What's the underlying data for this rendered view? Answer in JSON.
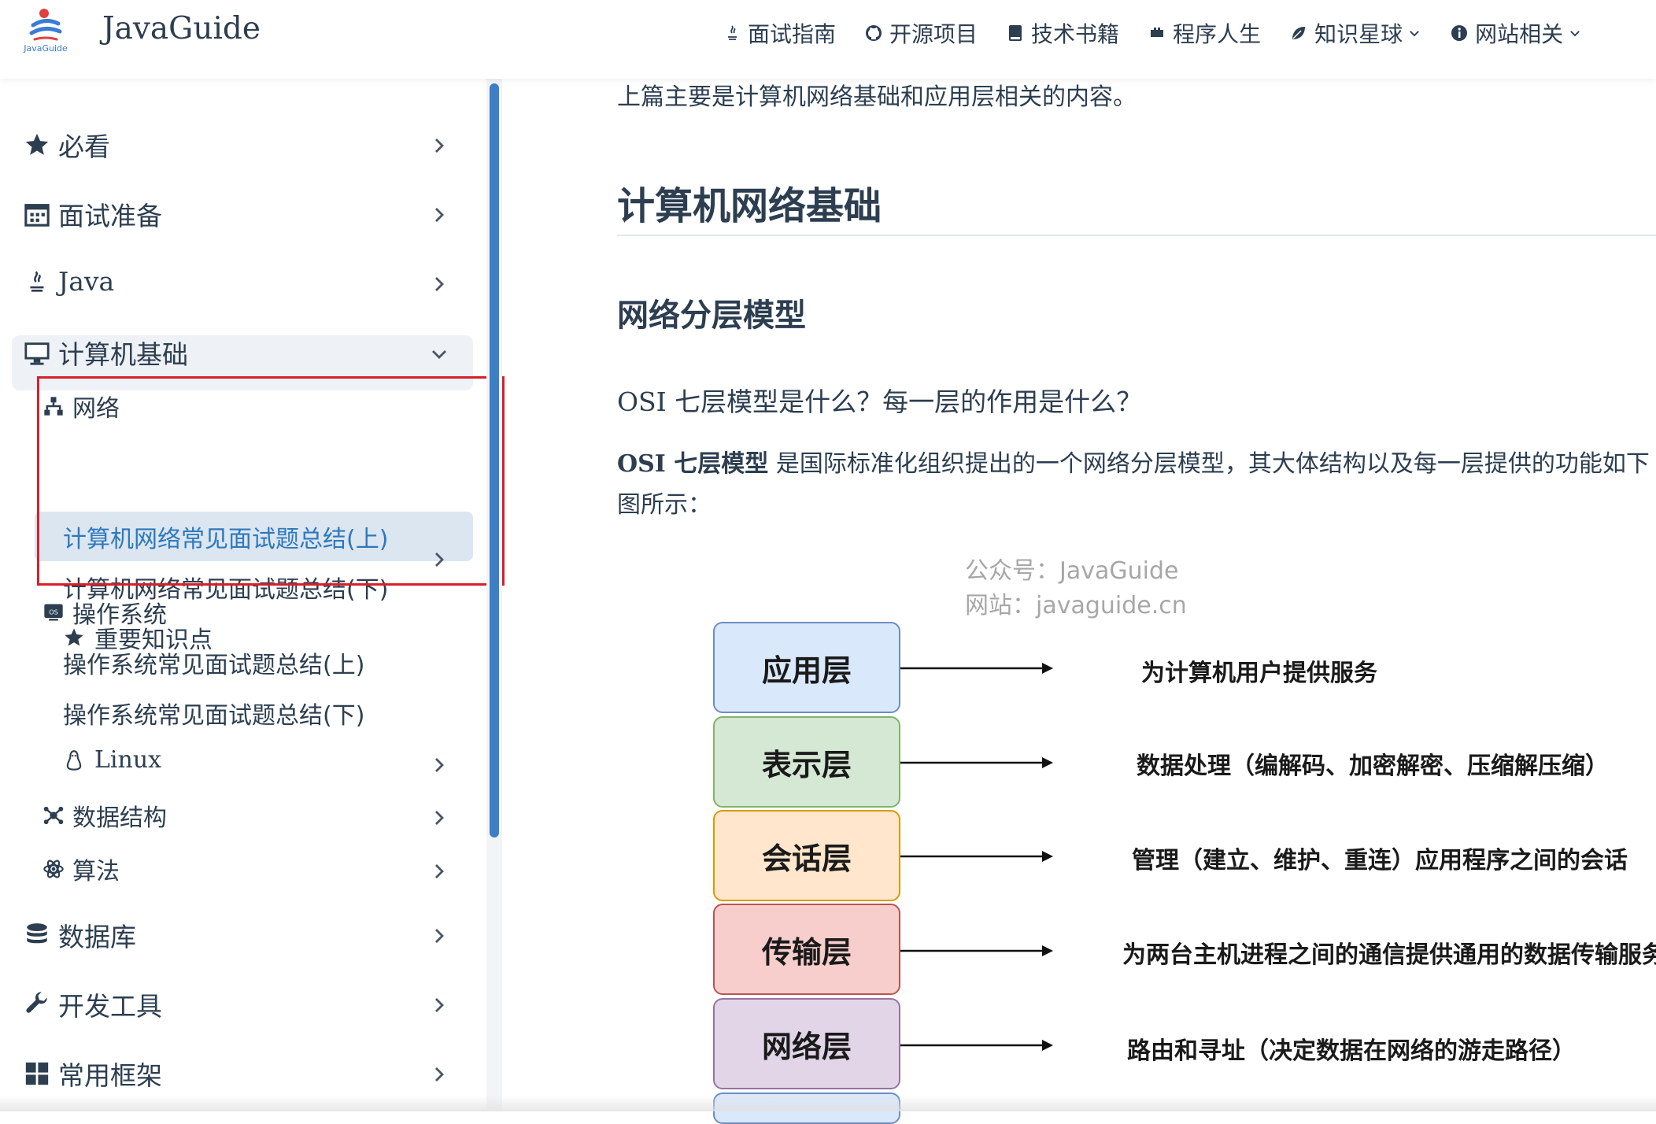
{
  "navbar": {
    "site_name": "JavaGuide",
    "logo_text": "JavaGuide",
    "links": [
      {
        "label": "面试指南",
        "icon": "java-icon"
      },
      {
        "label": "开源项目",
        "icon": "github-icon"
      },
      {
        "label": "技术书籍",
        "icon": "book-icon"
      },
      {
        "label": "程序人生",
        "icon": "life-icon"
      },
      {
        "label": "知识星球",
        "icon": "planet-icon",
        "dropdown": true
      },
      {
        "label": "网站相关",
        "icon": "info-icon",
        "dropdown": true
      }
    ]
  },
  "sidebar": {
    "items": [
      {
        "label": "必看",
        "icon": "star-icon"
      },
      {
        "label": "面试准备",
        "icon": "calendar-icon"
      },
      {
        "label": "Java",
        "icon": "java-icon"
      },
      {
        "label": "计算机基础",
        "icon": "desktop-icon"
      },
      {
        "label": "网络",
        "icon": "network-icon"
      },
      {
        "label": "计算机网络常见面试题总结(上)"
      },
      {
        "label": "计算机网络常见面试题总结(下)"
      },
      {
        "label": "重要知识点",
        "icon": "star-icon"
      },
      {
        "label": "操作系统",
        "icon": "os-icon"
      },
      {
        "label": "操作系统常见面试题总结(上)"
      },
      {
        "label": "操作系统常见面试题总结(下)"
      },
      {
        "label": "Linux",
        "icon": "linux-icon"
      },
      {
        "label": "数据结构",
        "icon": "data-structure-icon"
      },
      {
        "label": "算法",
        "icon": "algorithm-icon"
      },
      {
        "label": "数据库",
        "icon": "database-icon"
      },
      {
        "label": "开发工具",
        "icon": "wrench-icon"
      },
      {
        "label": "常用框架",
        "icon": "grid-icon"
      }
    ]
  },
  "content": {
    "intro": "上篇主要是计算机网络基础和应用层相关的内容。",
    "h2": "计算机网络基础",
    "h3": "网络分层模型",
    "h4": "OSI 七层模型是什么？每一层的作用是什么？",
    "para_bold": "OSI 七层模型",
    "para_rest": " 是国际标准化组织提出的一个网络分层模型，其大体结构以及每一层提供的功能如下图所示：",
    "watermark_1": "公众号：JavaGuide",
    "watermark_2": "网站：javaguide.cn",
    "layers": [
      {
        "name": "应用层",
        "desc": "为计算机用户提供服务",
        "fill": "#dae8fc",
        "stroke": "#6c8ebf"
      },
      {
        "name": "表示层",
        "desc": "数据处理（编解码、加密解密、压缩解压缩）",
        "fill": "#d5e8d4",
        "stroke": "#82b366"
      },
      {
        "name": "会话层",
        "desc": "管理（建立、维护、重连）应用程序之间的会话",
        "fill": "#ffe6cc",
        "stroke": "#d79b00"
      },
      {
        "name": "传输层",
        "desc": "为两台主机进程之间的通信提供通用的数据传输服务",
        "fill": "#f8cecc",
        "stroke": "#b85450"
      },
      {
        "name": "网络层",
        "desc": "路由和寻址（决定数据在网络的游走路径）",
        "fill": "#e1d5e7",
        "stroke": "#9673a6"
      }
    ]
  }
}
